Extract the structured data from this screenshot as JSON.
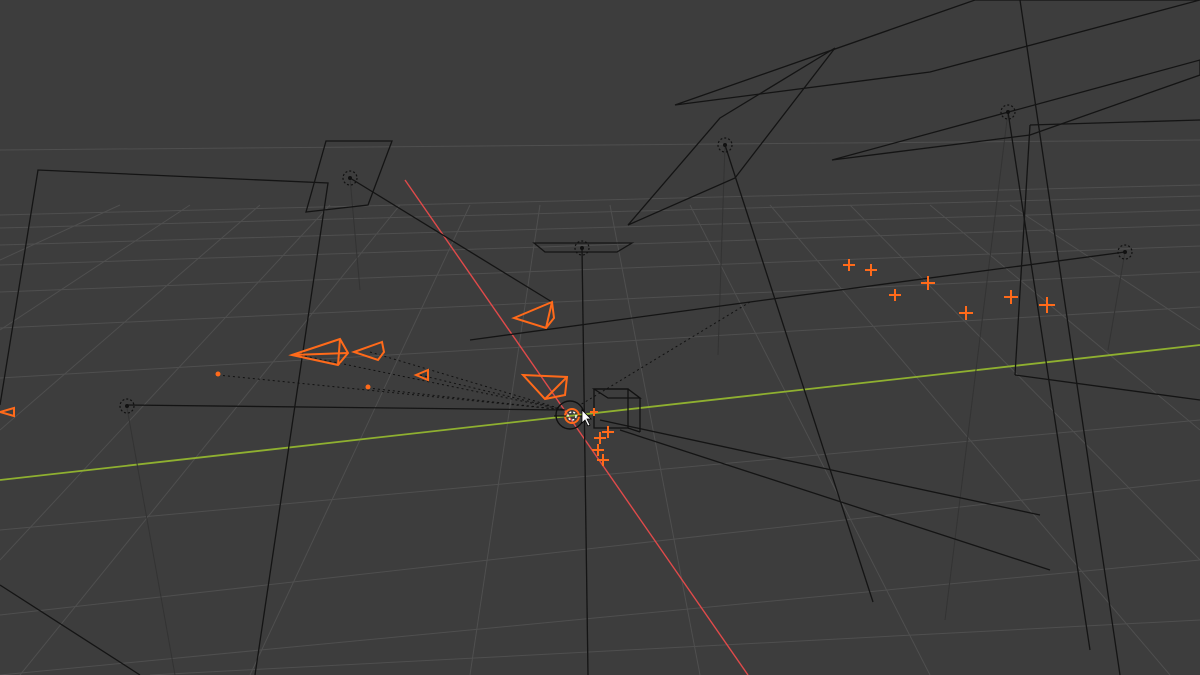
{
  "viewport": {
    "background": "#3d3d3d",
    "grid_color": "#555555",
    "x_axis_color": "#e04040",
    "y_axis_color": "#8fb030",
    "wire_color": "#111111",
    "selection_color": "#ff6a1a"
  },
  "objects": {
    "lights": [
      "area-light",
      "area-light",
      "area-light",
      "area-light",
      "area-light",
      "point-light",
      "point-light"
    ],
    "selected_cameras": 6,
    "selected_empties": 10,
    "cube": "cube-wireframe"
  },
  "cursor": {
    "icon": "3d-cursor-icon",
    "pointer": "mouse-pointer-icon"
  }
}
